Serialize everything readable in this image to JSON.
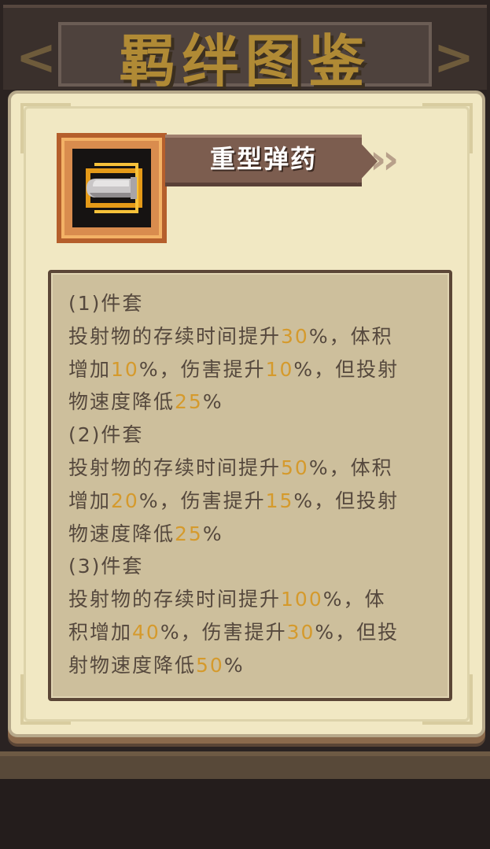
{
  "header": {
    "title": "羁绊图鉴"
  },
  "item": {
    "icon": "bullet-icon",
    "name": "重型弹药"
  },
  "tiers": [
    {
      "title": "(1)件套",
      "lines": [
        [
          {
            "t": "投射物的存续时间提升"
          },
          {
            "t": "30",
            "n": true
          },
          {
            "t": "%，体积"
          }
        ],
        [
          {
            "t": "增加"
          },
          {
            "t": "10",
            "n": true
          },
          {
            "t": "%，伤害提升"
          },
          {
            "t": "10",
            "n": true
          },
          {
            "t": "%，但投射"
          }
        ],
        [
          {
            "t": "物速度降低"
          },
          {
            "t": "25",
            "n": true
          },
          {
            "t": "%"
          }
        ]
      ]
    },
    {
      "title": "(2)件套",
      "lines": [
        [
          {
            "t": "投射物的存续时间提升"
          },
          {
            "t": "50",
            "n": true
          },
          {
            "t": "%，体积"
          }
        ],
        [
          {
            "t": "增加"
          },
          {
            "t": "20",
            "n": true
          },
          {
            "t": "%，伤害提升"
          },
          {
            "t": "15",
            "n": true
          },
          {
            "t": "%，但投射"
          }
        ],
        [
          {
            "t": "物速度降低"
          },
          {
            "t": "25",
            "n": true
          },
          {
            "t": "%"
          }
        ]
      ]
    },
    {
      "title": "(3)件套",
      "lines": [
        [
          {
            "t": "投射物的存续时间提升"
          },
          {
            "t": "100",
            "n": true
          },
          {
            "t": "%，体"
          }
        ],
        [
          {
            "t": "积增加"
          },
          {
            "t": "40",
            "n": true
          },
          {
            "t": "%，伤害提升"
          },
          {
            "t": "30",
            "n": true
          },
          {
            "t": "%，但投"
          }
        ],
        [
          {
            "t": "射物速度降低"
          },
          {
            "t": "50",
            "n": true
          },
          {
            "t": "%"
          }
        ]
      ]
    }
  ],
  "colors": {
    "highlight_number": "#d59a2c",
    "body_text": "#55483d",
    "panel": "#f1e8c3"
  }
}
